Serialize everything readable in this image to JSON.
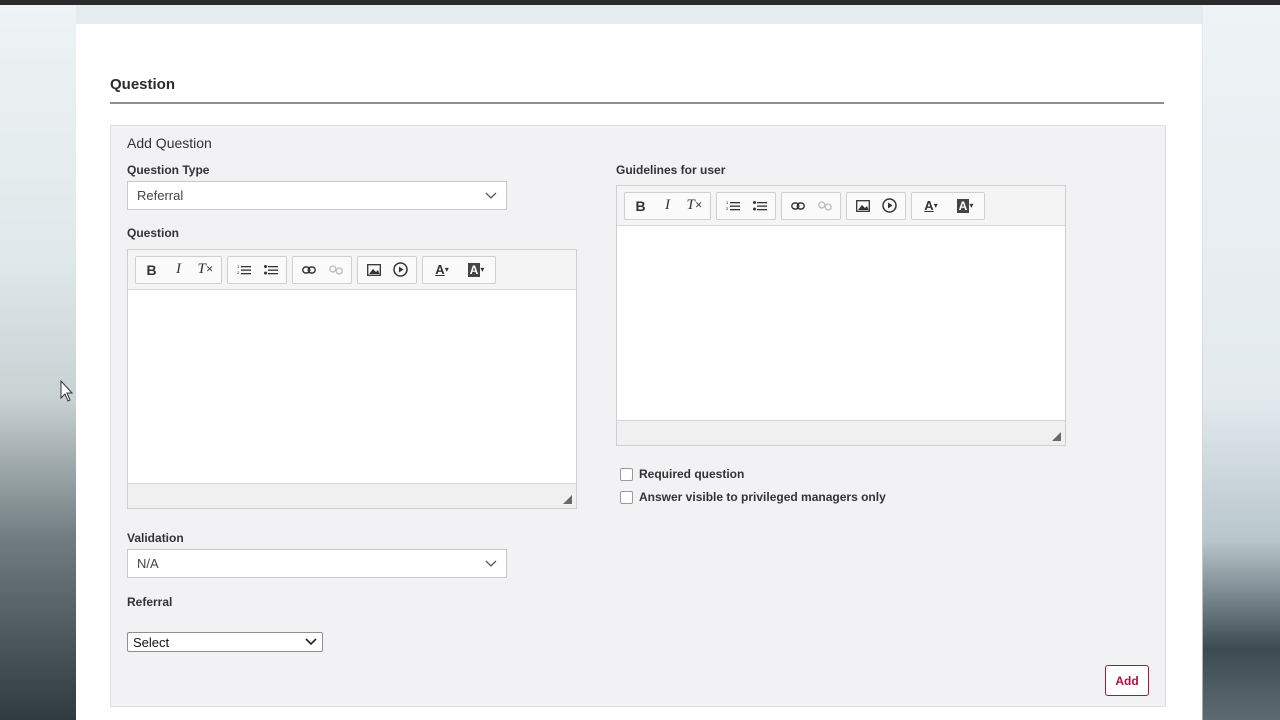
{
  "section": {
    "title": "Question"
  },
  "form": {
    "box_title": "Add Question",
    "question_type": {
      "label": "Question Type",
      "value": "Referral"
    },
    "question": {
      "label": "Question"
    },
    "guidelines": {
      "label": "Guidelines for user"
    },
    "toolbar": {
      "bold": "B",
      "italic": "I",
      "clear_format": "T",
      "font_color": "A",
      "bg_color": "A"
    },
    "required": {
      "label": "Required question",
      "checked": false
    },
    "visible_privileged": {
      "label": "Answer visible to privileged managers only",
      "checked": false
    },
    "validation": {
      "label": "Validation",
      "value": "N/A"
    },
    "referral": {
      "label": "Referral",
      "value": "Select"
    },
    "add_button": "Add"
  },
  "colors": {
    "accent": "#a4163a",
    "topbar": "#2b2b2b",
    "box_bg": "#f2f2f4"
  },
  "icons": [
    "bold-icon",
    "italic-icon",
    "clear-format-icon",
    "numbered-list-icon",
    "bulleted-list-icon",
    "link-icon",
    "unlink-icon",
    "image-icon",
    "video-icon",
    "font-color-icon",
    "background-color-icon",
    "chevron-down-icon",
    "resize-handle-icon"
  ]
}
